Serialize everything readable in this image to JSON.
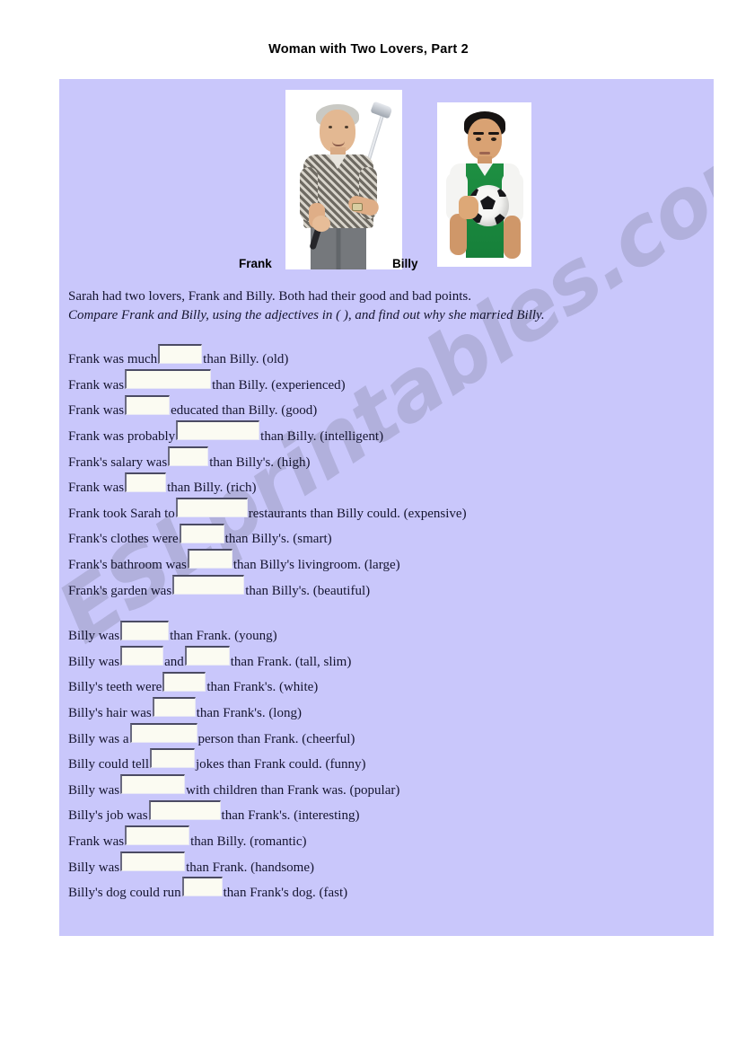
{
  "title": "Woman with Two Lovers, Part 2",
  "colors": {
    "panel_background": "#c9c7fb",
    "text": "#151530",
    "blank_fill": "#fbfbf2",
    "watermark": "#9e9ec4"
  },
  "watermark": "ESLprintables.com",
  "photos": {
    "frank_label": "Frank",
    "billy_label": "Billy"
  },
  "intro": {
    "line1": "Sarah had two lovers, Frank and Billy. Both had their good and bad points.",
    "line2": "Compare Frank and Billy, using the adjectives in ( ), and find out why she married Billy."
  },
  "exercises": [
    {
      "before": "Frank was much",
      "blank_width": 49,
      "after": "than Billy. (old)"
    },
    {
      "before": "Frank was",
      "blank_width": 96,
      "after": "than Billy. (experienced)"
    },
    {
      "before": "Frank was",
      "blank_width": 50,
      "after": "educated than Billy. (good)"
    },
    {
      "before": "Frank was probably",
      "blank_width": 93,
      "after": "than Billy. (intelligent)"
    },
    {
      "before": "Frank's salary was",
      "blank_width": 45,
      "after": "than Billy's. (high)"
    },
    {
      "before": "Frank was",
      "blank_width": 46,
      "after": "than Billy. (rich)"
    },
    {
      "before": "Frank took Sarah to",
      "blank_width": 80,
      "after": "restaurants than Billy could. (expensive)"
    },
    {
      "before": "Frank's clothes were",
      "blank_width": 50,
      "after": "than Billy's. (smart)"
    },
    {
      "before": "Frank's bathroom was",
      "blank_width": 50,
      "after": "than Billy's livingroom. (large)"
    },
    {
      "before": "Frank's garden was",
      "blank_width": 80,
      "after": "than Billy's. (beautiful)"
    },
    {
      "group_break": true
    },
    {
      "before": "Billy was",
      "blank_width": 54,
      "after": "than Frank. (young)"
    },
    {
      "before": "Billy was",
      "blank_width": 48,
      "middle": "and",
      "blank2_width": 50,
      "after": "than Frank. (tall, slim)"
    },
    {
      "before": "Billy's teeth were",
      "blank_width": 48,
      "after": "than Frank's. (white)"
    },
    {
      "before": "Billy's hair was",
      "blank_width": 48,
      "after": "than Frank's. (long)"
    },
    {
      "before": "Billy was a",
      "blank_width": 75,
      "after": "person than Frank. (cheerful)"
    },
    {
      "before": "Billy could tell",
      "blank_width": 50,
      "after": "jokes than Frank could. (funny)"
    },
    {
      "before": "Billy was",
      "blank_width": 72,
      "after": "with children than Frank was. (popular)"
    },
    {
      "before": "Billy's job was",
      "blank_width": 80,
      "after": "than Frank's. (interesting)"
    },
    {
      "before": "Frank was",
      "blank_width": 72,
      "after": "than Billy. (romantic)"
    },
    {
      "before": "Billy was",
      "blank_width": 72,
      "after": "than Frank. (handsome)"
    },
    {
      "before": "Billy's dog could run",
      "blank_width": 45,
      "after": "than Frank's dog. (fast)"
    }
  ]
}
